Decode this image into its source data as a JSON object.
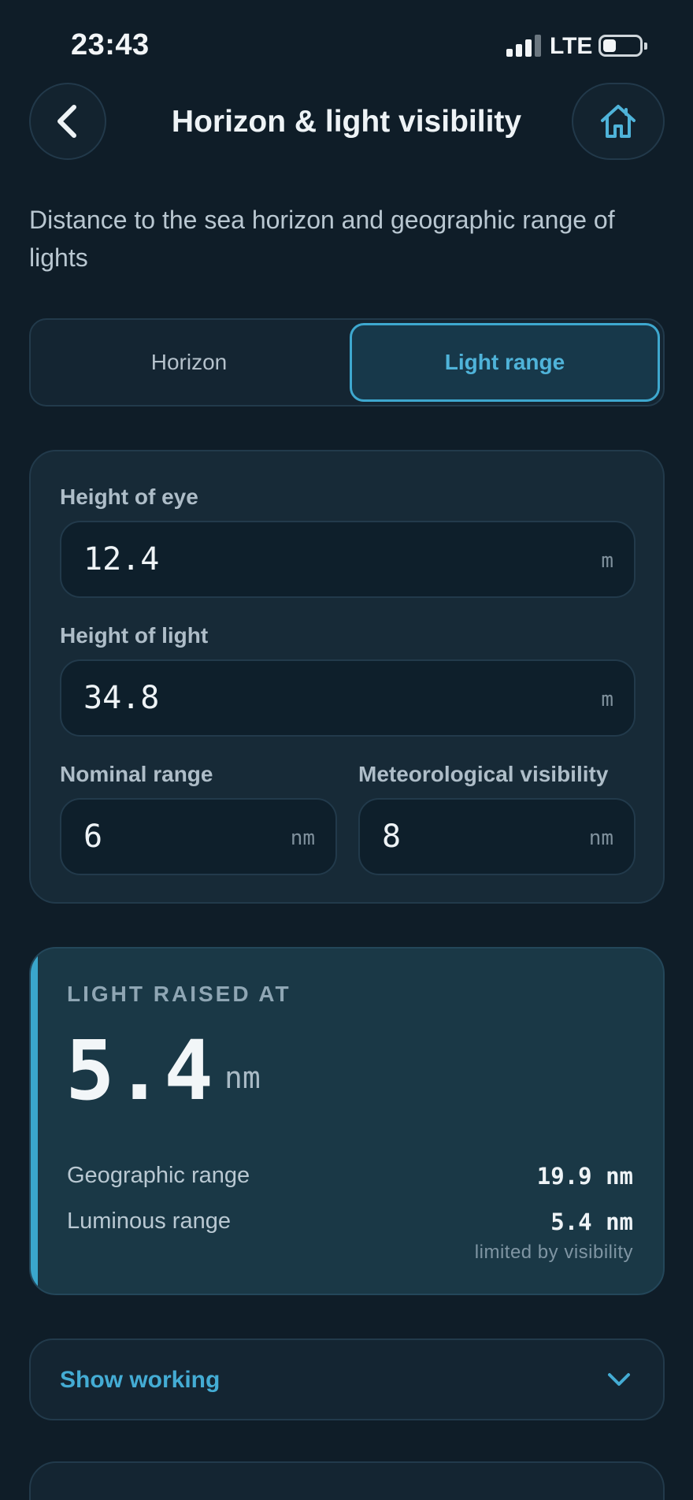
{
  "status_bar": {
    "time": "23:43",
    "network": "LTE"
  },
  "header": {
    "title": "Horizon & light visibility"
  },
  "subtitle": "Distance to the sea horizon and geographic range of lights",
  "tabs": [
    {
      "label": "Horizon",
      "selected": false
    },
    {
      "label": "Light range",
      "selected": true
    }
  ],
  "inputs": {
    "height_of_eye": {
      "label": "Height of eye",
      "value": "12.4",
      "unit": "m"
    },
    "height_of_light": {
      "label": "Height of light",
      "value": "34.8",
      "unit": "m"
    },
    "nominal_range": {
      "label": "Nominal range",
      "value": "6",
      "unit": "nm"
    },
    "met_visibility": {
      "label": "Meteorological visibility",
      "value": "8",
      "unit": "nm"
    }
  },
  "result": {
    "label": "LIGHT RAISED AT",
    "value": "5.4",
    "unit": "nm",
    "geographic_range": {
      "label": "Geographic range",
      "value": "19.9 nm"
    },
    "luminous_range": {
      "label": "Luminous range",
      "value": "5.4 nm",
      "note": "limited by visibility"
    }
  },
  "show_working": {
    "label": "Show working"
  },
  "colors": {
    "background": "#0f1d28",
    "accent": "#3ea8cf",
    "card": "#172a37",
    "result_card": "#1a3846"
  },
  "icons": {
    "back": "chevron-left-icon",
    "home": "home-icon",
    "expand": "chevron-down-icon"
  }
}
